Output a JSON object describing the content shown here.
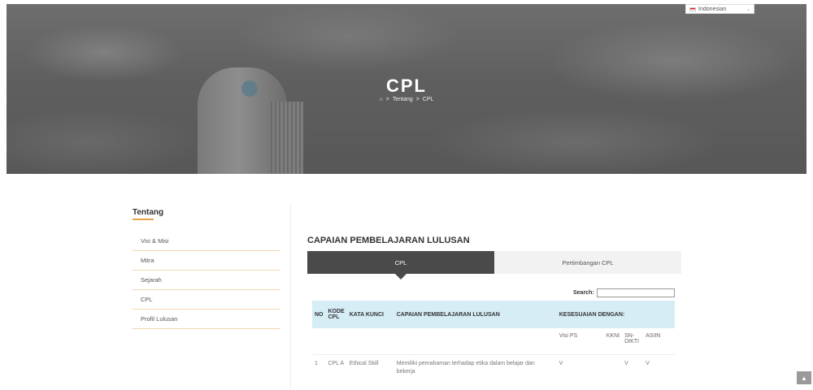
{
  "language": {
    "selected": "Indonesian"
  },
  "hero": {
    "title": "CPL",
    "breadcrumb": {
      "home_icon": "home-icon",
      "sep1": ">",
      "parent": "Tentang",
      "sep2": ">",
      "current": "CPL"
    }
  },
  "sidebar": {
    "title": "Tentang",
    "items": [
      {
        "label": "Visi & Misi"
      },
      {
        "label": "Mitra"
      },
      {
        "label": "Sejarah"
      },
      {
        "label": "CPL"
      },
      {
        "label": "Profil Lulusan"
      }
    ]
  },
  "main": {
    "title": "CAPAIAN PEMBELAJARAN LULUSAN",
    "tabs": [
      {
        "label": "CPL",
        "active": true
      },
      {
        "label": "Pertimbangan CPL",
        "active": false
      }
    ],
    "search_label": "Search:",
    "table": {
      "headers": [
        "NO",
        "KODE CPL",
        "KATA KUNCI",
        "CAPAIAN PEMBELAJARAN LULUSAN",
        "KESESUAIAN DENGAN:"
      ],
      "subheaders": [
        "Visi PS",
        "KKNI",
        "SN-DIKTI",
        "ASIIN"
      ],
      "rows": [
        {
          "no": "1",
          "kode": "CPL A",
          "kata_kunci": "Ethical Skill",
          "capaian": "Memiliki pemahaman terhadap etika dalam belajar dan bekerja",
          "visi_ps": "V",
          "kkni": "",
          "sn_dikti": "V",
          "asiin": "V"
        }
      ]
    }
  },
  "colors": {
    "accent": "#e8a24a",
    "tab_active": "#4a4a4a",
    "table_header": "#d6edf6"
  }
}
